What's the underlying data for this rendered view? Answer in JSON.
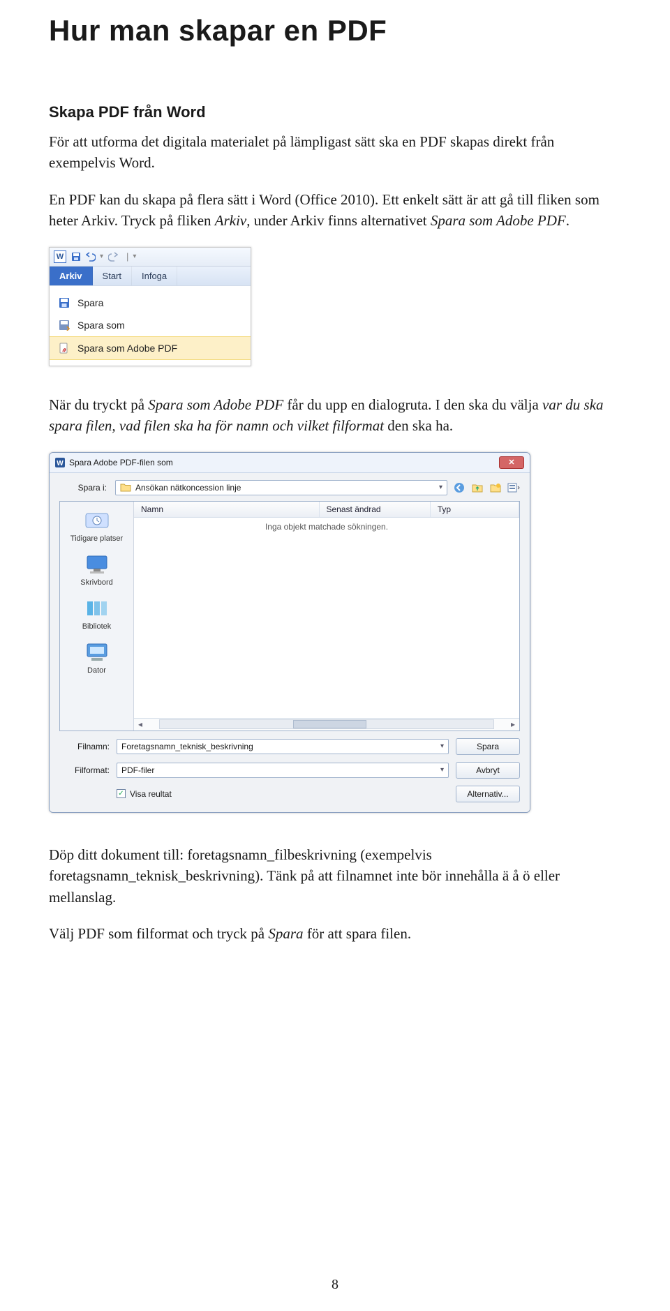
{
  "title": "Hur man skapar en PDF",
  "subtitle": "Skapa PDF från Word",
  "para1": "För att utforma det digitala materialet på lämpligast sätt ska en PDF skapas direkt från exempelvis Word.",
  "para2a": "En PDF kan du skapa på flera sätt i Word (Office 2010). Ett enkelt sätt är att gå till fliken som heter Arkiv. Tryck på fliken ",
  "para2b": "Arkiv",
  "para2c": ", under Arkiv finns alternativet ",
  "para2d": "Spara som Adobe PDF",
  "para2e": ".",
  "word": {
    "tabs": [
      "Arkiv",
      "Start",
      "Infoga"
    ],
    "menu": [
      "Spara",
      "Spara som",
      "Spara som Adobe PDF"
    ]
  },
  "para3a": "När du tryckt på ",
  "para3b": "Spara som Adobe PDF",
  "para3c": " får du upp en dialogruta. I den ska du välja ",
  "para3d": "var du ska spara filen, vad filen ska ha för namn och vilket filformat",
  "para3e": " den ska ha.",
  "dialog": {
    "title": "Spara Adobe PDF-filen som",
    "saveInLabel": "Spara i:",
    "folder": "Ansökan nätkoncession linje",
    "cols": [
      "Namn",
      "Senast ändrad",
      "Typ"
    ],
    "empty": "Inga objekt matchade sökningen.",
    "places": [
      "Tidigare platser",
      "Skrivbord",
      "Bibliotek",
      "Dator"
    ],
    "filnamnLabel": "Filnamn:",
    "filnamn": "Foretagsnamn_teknisk_beskrivning",
    "filformatLabel": "Filformat:",
    "filformat": "PDF-filer",
    "visa": "Visa reultat",
    "spara": "Spara",
    "avbryt": "Avbryt",
    "alternativ": "Alternativ..."
  },
  "para4": "Döp ditt dokument till: foretagsnamn_filbeskrivning (exempelvis foretagsnamn_teknisk_beskrivning). Tänk på att filnamnet inte bör innehålla ä å ö eller mellanslag.",
  "para5a": "Välj PDF som filformat och tryck på ",
  "para5b": "Spara",
  "para5c": " för att spara filen.",
  "pagenum": "8"
}
